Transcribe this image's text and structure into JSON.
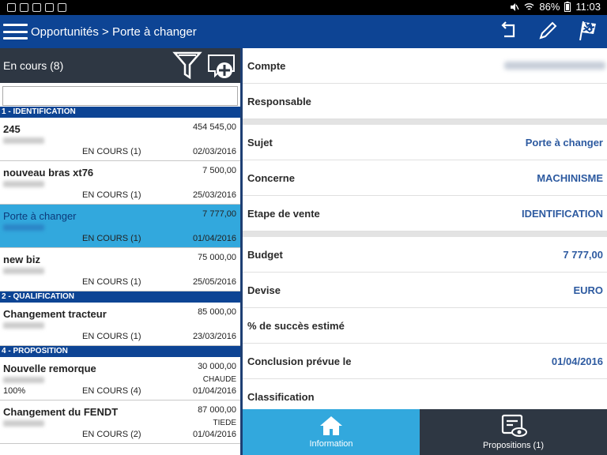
{
  "status_bar": {
    "battery": "86%",
    "time": "11:03"
  },
  "app_bar": {
    "title": "Opportunités > Porte à changer"
  },
  "list": {
    "header": "En cours (8)",
    "search_placeholder": "",
    "sections": [
      {
        "title": "1 - IDENTIFICATION",
        "items": [
          {
            "name": "245",
            "amount": "454 545,00",
            "status": "EN COURS  (1)",
            "date": "02/03/2016",
            "tag": "",
            "pct": "",
            "selected": false
          },
          {
            "name": "nouveau bras xt76",
            "amount": "7 500,00",
            "status": "EN COURS  (1)",
            "date": "25/03/2016",
            "tag": "",
            "pct": "",
            "selected": false
          },
          {
            "name": "Porte à changer",
            "amount": "7 777,00",
            "status": "EN COURS  (1)",
            "date": "01/04/2016",
            "tag": "",
            "pct": "",
            "selected": true
          },
          {
            "name": "new biz",
            "amount": "75 000,00",
            "status": "EN COURS  (1)",
            "date": "25/05/2016",
            "tag": "",
            "pct": "",
            "selected": false
          }
        ]
      },
      {
        "title": "2 - QUALIFICATION",
        "items": [
          {
            "name": "Changement tracteur",
            "amount": "85 000,00",
            "status": "EN COURS  (1)",
            "date": "23/03/2016",
            "tag": "",
            "pct": "",
            "selected": false
          }
        ]
      },
      {
        "title": "4 - PROPOSITION",
        "items": [
          {
            "name": "Nouvelle remorque",
            "amount": "30 000,00",
            "status": "EN COURS  (4)",
            "date": "01/04/2016",
            "tag": "CHAUDE",
            "pct": "100%",
            "selected": false
          },
          {
            "name": "Changement du FENDT",
            "amount": "87 000,00",
            "status": "EN COURS  (2)",
            "date": "01/04/2016",
            "tag": "TIEDE",
            "pct": "",
            "selected": false
          }
        ]
      }
    ]
  },
  "details": {
    "group1": [
      {
        "label": "Compte",
        "value": "",
        "blurred": true
      },
      {
        "label": "Responsable",
        "value": "",
        "blurred": false
      }
    ],
    "group2": [
      {
        "label": "Sujet",
        "value": "Porte à changer"
      },
      {
        "label": "Concerne",
        "value": "MACHINISME"
      },
      {
        "label": "Etape de vente",
        "value": "IDENTIFICATION"
      }
    ],
    "group3": [
      {
        "label": "Budget",
        "value": "7 777,00"
      },
      {
        "label": "Devise",
        "value": "EURO"
      },
      {
        "label": "% de succès estimé",
        "value": ""
      },
      {
        "label": "Conclusion prévue le",
        "value": "01/04/2016"
      },
      {
        "label": "Classification",
        "value": ""
      }
    ]
  },
  "bottom_nav": {
    "information": "Information",
    "propositions": "Propositions  (1)"
  },
  "colors": {
    "primary": "#0d4494",
    "accent": "#32a8dd",
    "dark": "#2e3743",
    "value": "#2d5aa0"
  }
}
